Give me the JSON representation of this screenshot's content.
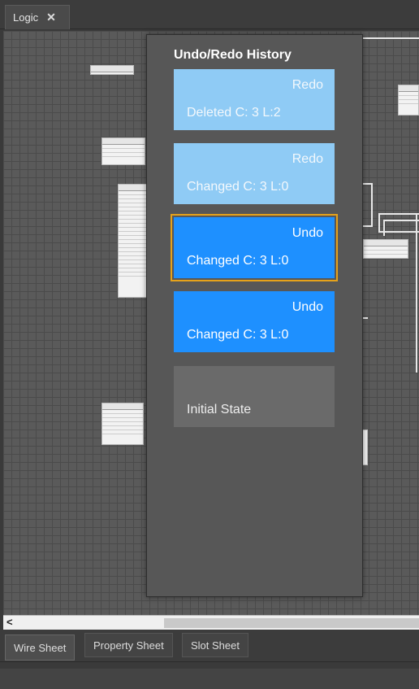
{
  "tab": {
    "label": "Logic",
    "close_glyph": "✕"
  },
  "history": {
    "title": "Undo/Redo History",
    "items": [
      {
        "kind": "redo",
        "action": "Redo",
        "description": "Deleted C: 3 L:2"
      },
      {
        "kind": "redo",
        "action": "Redo",
        "description": "Changed C: 3 L:0"
      },
      {
        "kind": "undo",
        "action": "Undo",
        "description": "Changed C: 3 L:0",
        "current": true
      },
      {
        "kind": "undo",
        "action": "Undo",
        "description": "Changed C: 3 L:0"
      },
      {
        "kind": "initial",
        "action": "",
        "description": "Initial State"
      }
    ],
    "colors": {
      "redo": "#8fcbf5",
      "undo": "#1e90ff",
      "initial": "#6a6a6a",
      "selected_border": "#e5a21b"
    }
  },
  "scrollbar": {
    "left_arrow": "<"
  },
  "sheet_tabs": [
    {
      "label": "Wire Sheet",
      "active": true
    },
    {
      "label": "Property Sheet",
      "active": false
    },
    {
      "label": "Slot Sheet",
      "active": false
    }
  ]
}
